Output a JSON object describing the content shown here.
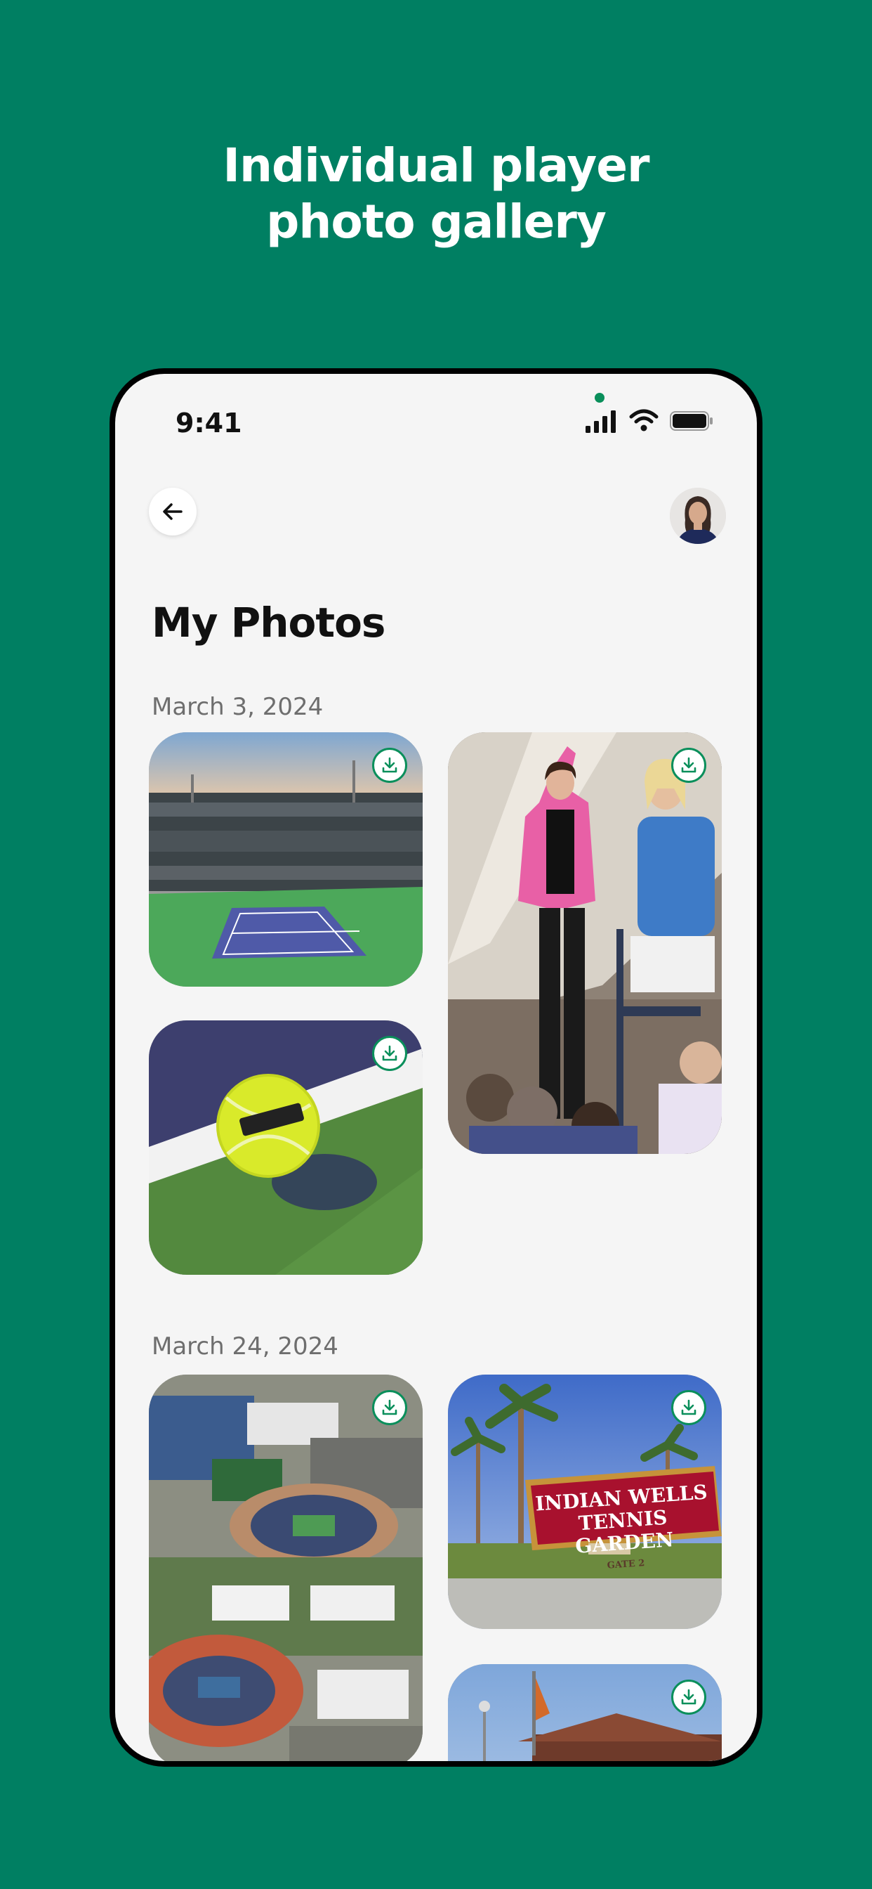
{
  "promo": {
    "headline_line1": "Individual player",
    "headline_line2": "photo gallery"
  },
  "status_bar": {
    "time": "9:41"
  },
  "header": {
    "back_icon": "arrow-left-icon",
    "avatar": "player-avatar"
  },
  "page": {
    "title": "My Photos"
  },
  "groups": [
    {
      "date": "March 3, 2024",
      "photos": [
        {
          "subject": "stadium-court",
          "download_icon": "download-icon"
        },
        {
          "subject": "fans-celebrating",
          "download_icon": "download-icon"
        },
        {
          "subject": "tennis-ball-on-court",
          "download_icon": "download-icon"
        }
      ]
    },
    {
      "date": "March 24, 2024",
      "photos": [
        {
          "subject": "aerial-tennis-garden",
          "download_icon": "download-icon"
        },
        {
          "subject": "indian-wells-sign",
          "download_icon": "download-icon",
          "sign_line1": "INDIAN WELLS",
          "sign_line2": "TENNIS GARDEN",
          "sign_gate": "GATE 2"
        },
        {
          "subject": "entrance-building",
          "download_icon": "download-icon"
        }
      ]
    }
  ],
  "colors": {
    "brand_green": "#007F62",
    "accent_green": "#0A8F5B"
  }
}
